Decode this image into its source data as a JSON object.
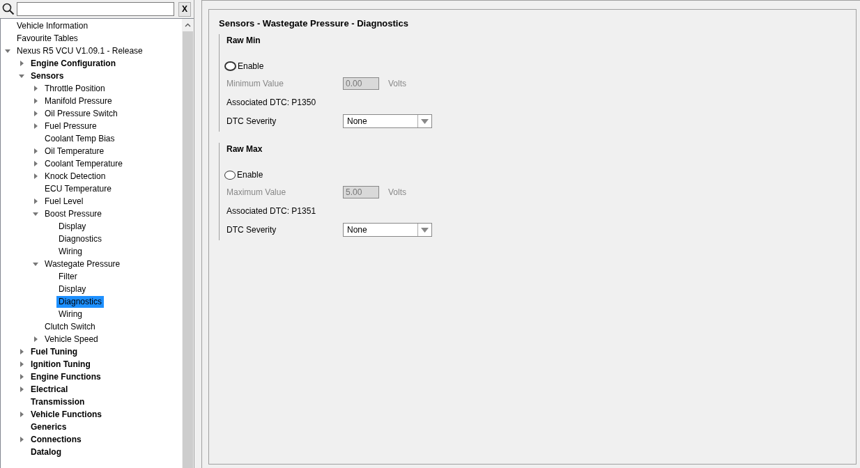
{
  "search": {
    "clear_button": "X"
  },
  "tree": [
    {
      "label": "Vehicle Information",
      "bold": false,
      "selected": false
    },
    {
      "label": "Favourite Tables",
      "bold": false,
      "selected": false
    },
    {
      "label": "Nexus R5 VCU V1.09.1 - Release",
      "bold": false,
      "expanded": true,
      "selected": false,
      "children": [
        {
          "label": "Engine Configuration",
          "bold": true,
          "expanded": false,
          "selected": false
        },
        {
          "label": "Sensors",
          "bold": true,
          "expanded": true,
          "selected": false,
          "children": [
            {
              "label": "Throttle Position",
              "bold": false,
              "expanded": false,
              "selected": false
            },
            {
              "label": "Manifold Pressure",
              "bold": false,
              "expanded": false,
              "selected": false
            },
            {
              "label": "Oil Pressure Switch",
              "bold": false,
              "expanded": false,
              "selected": false
            },
            {
              "label": "Fuel Pressure",
              "bold": false,
              "expanded": false,
              "selected": false
            },
            {
              "label": "Coolant Temp Bias",
              "bold": false,
              "selected": false
            },
            {
              "label": "Oil Temperature",
              "bold": false,
              "expanded": false,
              "selected": false
            },
            {
              "label": "Coolant Temperature",
              "bold": false,
              "expanded": false,
              "selected": false
            },
            {
              "label": "Knock Detection",
              "bold": false,
              "expanded": false,
              "selected": false
            },
            {
              "label": "ECU Temperature",
              "bold": false,
              "selected": false
            },
            {
              "label": "Fuel Level",
              "bold": false,
              "expanded": false,
              "selected": false
            },
            {
              "label": "Boost Pressure",
              "bold": false,
              "expanded": true,
              "selected": false,
              "children": [
                {
                  "label": "Display",
                  "bold": false,
                  "selected": false
                },
                {
                  "label": "Diagnostics",
                  "bold": false,
                  "selected": false
                },
                {
                  "label": "Wiring",
                  "bold": false,
                  "selected": false
                }
              ]
            },
            {
              "label": "Wastegate Pressure",
              "bold": false,
              "expanded": true,
              "selected": false,
              "children": [
                {
                  "label": "Filter",
                  "bold": false,
                  "selected": false
                },
                {
                  "label": "Display",
                  "bold": false,
                  "selected": false
                },
                {
                  "label": "Diagnostics",
                  "bold": false,
                  "selected": true
                },
                {
                  "label": "Wiring",
                  "bold": false,
                  "selected": false
                }
              ]
            },
            {
              "label": "Clutch Switch",
              "bold": false,
              "selected": false
            },
            {
              "label": "Vehicle Speed",
              "bold": false,
              "expanded": false,
              "selected": false
            }
          ]
        },
        {
          "label": "Fuel Tuning",
          "bold": true,
          "expanded": false,
          "selected": false
        },
        {
          "label": "Ignition Tuning",
          "bold": true,
          "expanded": false,
          "selected": false
        },
        {
          "label": "Engine Functions",
          "bold": true,
          "expanded": false,
          "selected": false
        },
        {
          "label": "Electrical",
          "bold": true,
          "expanded": false,
          "selected": false
        },
        {
          "label": "Transmission",
          "bold": true,
          "selected": false
        },
        {
          "label": "Vehicle Functions",
          "bold": true,
          "expanded": false,
          "selected": false
        },
        {
          "label": "Generics",
          "bold": true,
          "selected": false
        },
        {
          "label": "Connections",
          "bold": true,
          "expanded": false,
          "selected": false
        },
        {
          "label": "Datalog",
          "bold": true,
          "selected": false
        }
      ]
    }
  ],
  "panel": {
    "title": "Sensors - Wastegate Pressure - Diagnostics",
    "groups": [
      {
        "title": "Raw Min",
        "enable": {
          "label": "Enable",
          "checked": false,
          "focused": true
        },
        "value_label": "Minimum Value",
        "value": "0.00",
        "unit": "Volts",
        "disabled": true,
        "dtc": "Associated DTC: P1350",
        "severity_label": "DTC Severity",
        "severity": "None"
      },
      {
        "title": "Raw Max",
        "enable": {
          "label": "Enable",
          "checked": false,
          "focused": false
        },
        "value_label": "Maximum Value",
        "value": "5.00",
        "unit": "Volts",
        "disabled": true,
        "dtc": "Associated DTC: P1351",
        "severity_label": "DTC Severity",
        "severity": "None"
      }
    ]
  }
}
